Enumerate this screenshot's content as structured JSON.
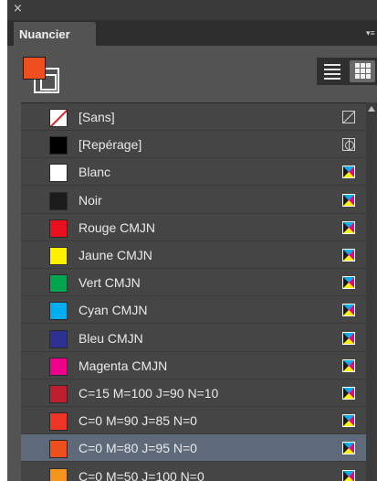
{
  "panel": {
    "close_glyph": "×",
    "tab_label": "Nuancier",
    "menu_glyph": "▾≡",
    "fill_color": "#ef4f1e"
  },
  "swatches": [
    {
      "label": "[Sans]",
      "color": "none",
      "icon": "none-swatch-icon",
      "selected": false
    },
    {
      "label": "[Repérage]",
      "color": "#000000",
      "icon": "registration-icon",
      "selected": false
    },
    {
      "label": "Blanc",
      "color": "#ffffff",
      "icon": "process-color-icon",
      "selected": false
    },
    {
      "label": "Noir",
      "color": "#1c1c1c",
      "icon": "process-color-icon",
      "selected": false
    },
    {
      "label": "Rouge CMJN",
      "color": "#e8101f",
      "icon": "process-color-icon",
      "selected": false
    },
    {
      "label": "Jaune CMJN",
      "color": "#fff200",
      "icon": "process-color-icon",
      "selected": false
    },
    {
      "label": "Vert CMJN",
      "color": "#00a54f",
      "icon": "process-color-icon",
      "selected": false
    },
    {
      "label": "Cyan CMJN",
      "color": "#00aeef",
      "icon": "process-color-icon",
      "selected": false
    },
    {
      "label": "Bleu CMJN",
      "color": "#2e3192",
      "icon": "process-color-icon",
      "selected": false
    },
    {
      "label": "Magenta CMJN",
      "color": "#ec008c",
      "icon": "process-color-icon",
      "selected": false
    },
    {
      "label": "C=15 M=100 J=90 N=10",
      "color": "#be1e2d",
      "icon": "process-color-icon",
      "selected": false
    },
    {
      "label": "C=0 M=90 J=85 N=0",
      "color": "#ee3528",
      "icon": "process-color-icon",
      "selected": false
    },
    {
      "label": "C=0 M=80 J=95 N=0",
      "color": "#ef4f1e",
      "icon": "process-color-icon",
      "selected": true
    },
    {
      "label": "C=0 M=50 J=100 N=0",
      "color": "#f7941d",
      "icon": "process-color-icon",
      "selected": false
    }
  ]
}
